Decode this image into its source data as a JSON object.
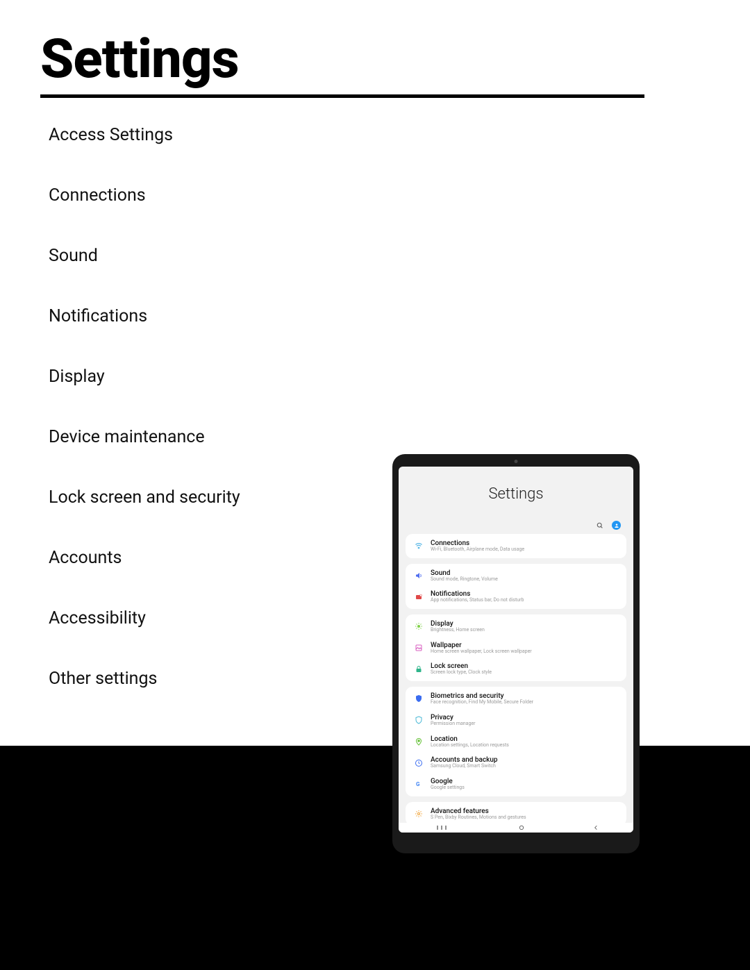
{
  "page_title": "Settings",
  "toc": [
    "Access Settings",
    "Connections",
    "Sound",
    "Notifications",
    "Display",
    "Device maintenance",
    "Lock screen and security",
    "Accounts",
    "Accessibility",
    "Other settings"
  ],
  "device": {
    "screen_title": "Settings",
    "groups": [
      [
        {
          "icon": "wifi",
          "color": "#5bb8e6",
          "title": "Connections",
          "sub": "Wi-Fi, Bluetooth, Airplane mode, Data usage"
        }
      ],
      [
        {
          "icon": "sound",
          "color": "#4f6df0",
          "title": "Sound",
          "sub": "Sound mode, Ringtone, Volume"
        },
        {
          "icon": "notif",
          "color": "#e04848",
          "title": "Notifications",
          "sub": "App notifications, Status bar, Do not disturb"
        }
      ],
      [
        {
          "icon": "display",
          "color": "#7fd148",
          "title": "Display",
          "sub": "Brightness, Home screen"
        },
        {
          "icon": "wallpaper",
          "color": "#d85fc0",
          "title": "Wallpaper",
          "sub": "Home screen wallpaper, Lock screen wallpaper"
        },
        {
          "icon": "lock",
          "color": "#2fb58b",
          "title": "Lock screen",
          "sub": "Screen lock type, Clock style"
        }
      ],
      [
        {
          "icon": "shield",
          "color": "#3a6cf0",
          "title": "Biometrics and security",
          "sub": "Face recognition, Find My Mobile, Secure Folder"
        },
        {
          "icon": "privacy",
          "color": "#49b8d6",
          "title": "Privacy",
          "sub": "Permission manager"
        },
        {
          "icon": "location",
          "color": "#67c23a",
          "title": "Location",
          "sub": "Location settings, Location requests"
        },
        {
          "icon": "accounts",
          "color": "#3a6cf0",
          "title": "Accounts and backup",
          "sub": "Samsung Cloud, Smart Switch"
        },
        {
          "icon": "google",
          "color": "#4285f4",
          "title": "Google",
          "sub": "Google settings"
        }
      ],
      [
        {
          "icon": "advanced",
          "color": "#f0a030",
          "title": "Advanced features",
          "sub": "S Pen, Bixby Routines, Motions and gestures"
        }
      ]
    ]
  }
}
